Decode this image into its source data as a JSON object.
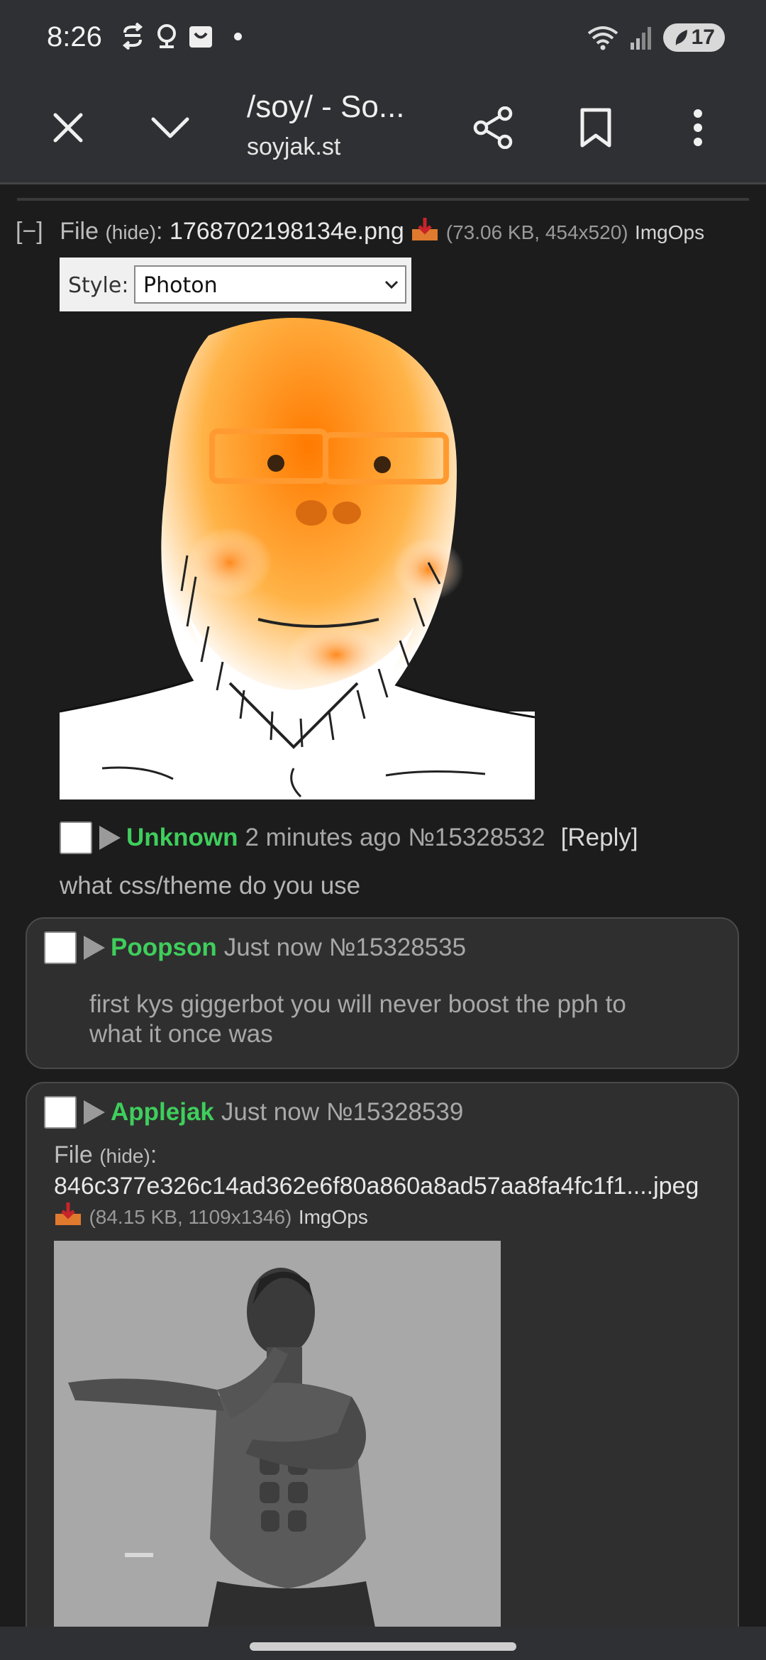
{
  "status_bar": {
    "time": "8:26",
    "battery": "17",
    "icons": [
      "sync-icon",
      "account-icon",
      "shopping-bag-icon",
      "notification-dot",
      "wifi-icon",
      "signal-icon",
      "battery-icon"
    ]
  },
  "toolbar": {
    "title": "/soy/ - So...",
    "url": "soyjak.st",
    "icons": [
      "close-icon",
      "chevron-down-icon",
      "share-icon",
      "bookmark-icon",
      "more-vert-icon"
    ]
  },
  "op": {
    "collapse": "[−]",
    "file_label": "File ",
    "hide_label": "(hide)",
    "colon": ": ",
    "filename": "1768702198134e.png",
    "file_meta": "(73.06 KB, 454x520)",
    "imgops": "ImgOps",
    "image_style_label": "Style:",
    "image_style_value": "Photon",
    "name": "Unknown",
    "time": "2 minutes ago",
    "number": "№15328532",
    "reply_label": "[Reply]",
    "body": "what css/theme do you use"
  },
  "replies": [
    {
      "name": "Poopson",
      "time": "Just now",
      "number": "№15328535",
      "body_line1": "first kys giggerbot you will never boost the pph to",
      "body_line2": "what it once was"
    },
    {
      "name": "Applejak",
      "time": "Just now",
      "number": "№15328539",
      "file_label": "File ",
      "hide_label": "(hide)",
      "colon": ":",
      "filename": "846c377e326c14ad362e6f80a860a8ad57aa8fa4fc1f1....jpeg",
      "file_meta": "(84.15 KB, 1109x1346)",
      "imgops": "ImgOps"
    }
  ],
  "colors": {
    "background": "#1c1c1c",
    "toolbar": "#2f3033",
    "name_green": "#3fce5c",
    "reply_bg": "#2f2f2f"
  }
}
